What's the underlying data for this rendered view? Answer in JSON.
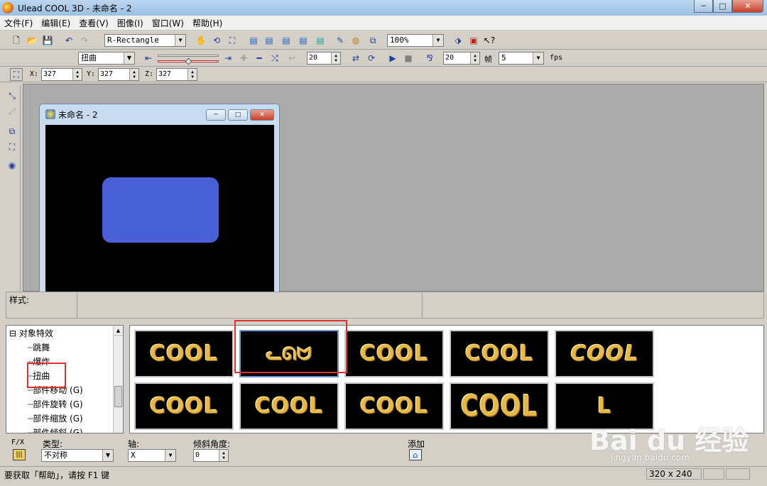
{
  "window": {
    "title": "Ulead COOL 3D - 未命名 - 2",
    "min_icon": "─",
    "max_icon": "□",
    "close_icon": "✕"
  },
  "menu": [
    "文件(F)",
    "编辑(E)",
    "查看(V)",
    "图像(I)",
    "窗口(W)",
    "帮助(H)"
  ],
  "toolbar1": {
    "object_select": "R-Rectangle",
    "zoom": "100%"
  },
  "toolbar2": {
    "effect_select": "扭曲",
    "frame_value": "20",
    "fps_frames": "20",
    "frame_label": "帧",
    "fps_value": "5",
    "fps_label": "fps"
  },
  "toolbar3": {
    "x_label": "X:",
    "x_value": "327",
    "y_label": "Y:",
    "y_value": "327",
    "z_label": "Z:",
    "z_value": "327"
  },
  "document": {
    "title": "未命名 - 2",
    "rect_color": "#4a5ed8"
  },
  "style_bar": {
    "label": "样式:"
  },
  "tree": {
    "root": "对象特效",
    "items": [
      "跳舞",
      "爆炸",
      "扭曲",
      "部件移动 (G)",
      "部件旋转 (G)",
      "部件缩放 (G)",
      "部件倾斜 (G)"
    ],
    "selected": "扭曲"
  },
  "gallery": {
    "thumbnails": [
      "COOL",
      "ᓚᘏᗢ",
      "COOL",
      "COOL",
      "COOL",
      "COOL",
      "COOL",
      "COOL",
      "COOL",
      "L"
    ],
    "selected_index": 1
  },
  "params": {
    "fx_label": "F/X",
    "type_label": "类型:",
    "type_value": "不对称",
    "axis_label": "轴:",
    "axis_value": "X",
    "tilt_label": "倾斜角度:",
    "tilt_value": "0",
    "add_label": "添加"
  },
  "status": {
    "help_text": "要获取「帮助」，请按 F1 键",
    "size_text": "320 x 240"
  },
  "watermark": {
    "brand": "Bai du 经验",
    "url": "jingyan.baidu.com"
  }
}
